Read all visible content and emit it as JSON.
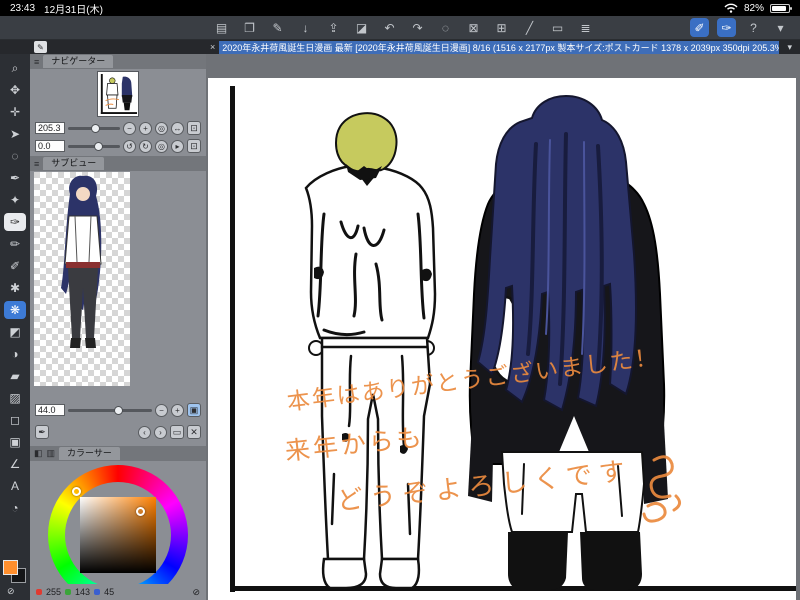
{
  "status_bar": {
    "time": "23:43",
    "date": "12月31日(木)",
    "battery_percent": "82%"
  },
  "tab_bar": {
    "close_glyph": "×",
    "pen_glyph": "✎",
    "title": "2020年永井荷風誕生日漫画 最新 [2020年永井荷風誕生日漫画] 8/16 (1516 x 2177px 製本サイズ:ポストカード 1378 x 2039px 350dpi 205.3%)",
    "chevron_glyph": "▾"
  },
  "toolbar": {
    "icons": [
      {
        "name": "menu",
        "glyph": "▤"
      },
      {
        "name": "tool-switch",
        "glyph": "❐"
      },
      {
        "name": "edit-canvas",
        "glyph": "✎"
      },
      {
        "name": "save",
        "glyph": "↓"
      },
      {
        "name": "export",
        "glyph": "⇪"
      },
      {
        "name": "eraser",
        "glyph": "◪"
      },
      {
        "name": "undo",
        "glyph": "↶"
      },
      {
        "name": "redo",
        "glyph": "↷"
      },
      {
        "name": "select-area",
        "glyph": "◌"
      },
      {
        "name": "deselect",
        "glyph": "⊠"
      },
      {
        "name": "crop",
        "glyph": "⊞"
      },
      {
        "name": "line",
        "glyph": "╱"
      },
      {
        "name": "shape",
        "glyph": "▭"
      },
      {
        "name": "layers",
        "glyph": "≣"
      },
      {
        "name": "pen-pressure",
        "glyph": "✐"
      },
      {
        "name": "stabilizer",
        "glyph": "✑"
      },
      {
        "name": "help",
        "glyph": "?"
      },
      {
        "name": "collapse",
        "glyph": "▾"
      }
    ]
  },
  "toolstrip": {
    "tools": [
      {
        "name": "zoom",
        "glyph": "⌕"
      },
      {
        "name": "hand",
        "glyph": "✥"
      },
      {
        "name": "move",
        "glyph": "✛"
      },
      {
        "name": "operation",
        "glyph": "➤"
      },
      {
        "name": "lasso",
        "glyph": "◌"
      },
      {
        "name": "selection-pen",
        "glyph": "✒"
      },
      {
        "name": "auto-select",
        "glyph": "✦"
      },
      {
        "name": "pen",
        "glyph": "✑"
      },
      {
        "name": "pencil",
        "glyph": "✏"
      },
      {
        "name": "brush",
        "glyph": "✐"
      },
      {
        "name": "airbrush",
        "glyph": "✱"
      },
      {
        "name": "decoration",
        "glyph": "❋"
      },
      {
        "name": "eraser",
        "glyph": "◩"
      },
      {
        "name": "blend",
        "glyph": "◑"
      },
      {
        "name": "fill",
        "glyph": "▰"
      },
      {
        "name": "gradient",
        "glyph": "▨"
      },
      {
        "name": "figure",
        "glyph": "◻"
      },
      {
        "name": "frame",
        "glyph": "▣"
      },
      {
        "name": "ruler",
        "glyph": "∠"
      },
      {
        "name": "text",
        "glyph": "A"
      },
      {
        "name": "eyedropper",
        "glyph": "◔"
      }
    ],
    "transparent_glyph": "⊘"
  },
  "navigator": {
    "title": "ナビゲーター",
    "menu_glyph": "≡",
    "zoom_value": "205.3",
    "rotate_value": "0.0",
    "zoom_buttons": [
      {
        "name": "zoom-out",
        "glyph": "−"
      },
      {
        "name": "zoom-in",
        "glyph": "+"
      },
      {
        "name": "zoom-reset",
        "glyph": "◎"
      },
      {
        "name": "flip-horizontal",
        "glyph": "↔"
      },
      {
        "name": "fit-screen",
        "glyph": "⊡"
      }
    ],
    "rotate_buttons": [
      {
        "name": "rotate-left",
        "glyph": "↺"
      },
      {
        "name": "rotate-right",
        "glyph": "↻"
      },
      {
        "name": "rotate-reset",
        "glyph": "◎"
      },
      {
        "name": "step",
        "glyph": "▸"
      },
      {
        "name": "fit",
        "glyph": "⊡"
      }
    ]
  },
  "subview": {
    "title": "サブビュー",
    "menu_glyph": "≡",
    "eyedropper_glyph": "✒",
    "prev_glyph": "‹",
    "next_glyph": "›",
    "folder_glyph": "▭",
    "trash_glyph": "✕"
  },
  "brush": {
    "size_value": "44.0",
    "minus_glyph": "−",
    "plus_glyph": "+",
    "preset_glyph": "▣"
  },
  "color_panel": {
    "title": "カラーサー",
    "icon1_glyph": "◧",
    "icon2_glyph": "▥",
    "r": "255",
    "g": "143",
    "b": "45",
    "transparent_glyph": "⊘",
    "selected_color": "#ff8f2d",
    "r_dot": "#e03a30",
    "g_dot": "#3aa53a",
    "b_dot": "#3a5fd0"
  },
  "canvas": {
    "handwriting_line1": "本年はありがとうございました！",
    "handwriting_line2": "来年からも",
    "handwriting_line3": "どうぞよろしくです",
    "ink_orange": "#ea8a3e",
    "hair_yellow": "#c6ca5e",
    "hair_blue": "#2c3368",
    "accent_blue": "#3e6db8"
  }
}
